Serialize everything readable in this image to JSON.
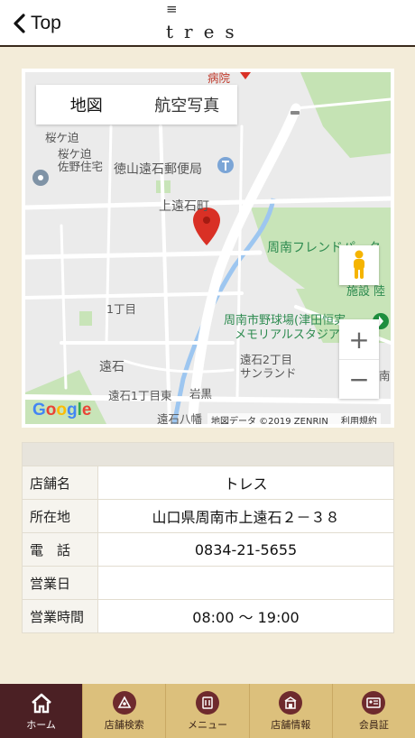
{
  "header": {
    "back_label": "Top",
    "logo_mark": "≡",
    "logo_text": "tres"
  },
  "map": {
    "type_tabs": [
      "地図",
      "航空写真"
    ],
    "labels": {
      "hospital": "病院",
      "sakuragasako": "桜ケ迫",
      "sakuragasako_sano": "桜ケ迫\n佐野住宅",
      "post_office": "徳山遠石郵便局",
      "kamitoishi": "上遠石町",
      "friend_park": "周南フレンドパーク",
      "facility": "市\n施設 陸",
      "itchome": "1丁目",
      "stadium_1": "周南市野球場(津田恒実",
      "stadium_2": "メモリアルスタジア",
      "toishi": "遠石",
      "toishi2": "遠石2丁目",
      "sunland": "サンランド",
      "minami": "南",
      "toishi1_higashi": "遠石1丁目東",
      "iwaguro": "岩黒",
      "toishi_hachiman": "遠石八幡"
    },
    "google_logo": "Google",
    "attribution": "地図データ ©2019 ZENRIN",
    "terms": "利用規約",
    "zoom_in": "+",
    "zoom_out": "−",
    "colors": {
      "pin": "#d93025",
      "park": "#c5e3b4",
      "river": "#9dc6f0",
      "road": "#ffffff"
    }
  },
  "info": {
    "rows": [
      {
        "label": "店舗名",
        "value": "トレス"
      },
      {
        "label": "所在地",
        "value": "山口県周南市上遠石２－３８"
      },
      {
        "label": "電　話",
        "value": "0834-21-5655"
      },
      {
        "label": "営業日",
        "value": ""
      },
      {
        "label": "営業時間",
        "value": "08:00 〜 19:00"
      }
    ]
  },
  "tabbar": {
    "tabs": [
      {
        "label": "ホーム",
        "icon": "home-icon",
        "active": true
      },
      {
        "label": "店舗検索",
        "icon": "store-search-icon",
        "active": false
      },
      {
        "label": "メニュー",
        "icon": "menu-icon",
        "active": false
      },
      {
        "label": "店舗情報",
        "icon": "store-info-icon",
        "active": false
      },
      {
        "label": "会員証",
        "icon": "member-card-icon",
        "active": false
      }
    ]
  }
}
